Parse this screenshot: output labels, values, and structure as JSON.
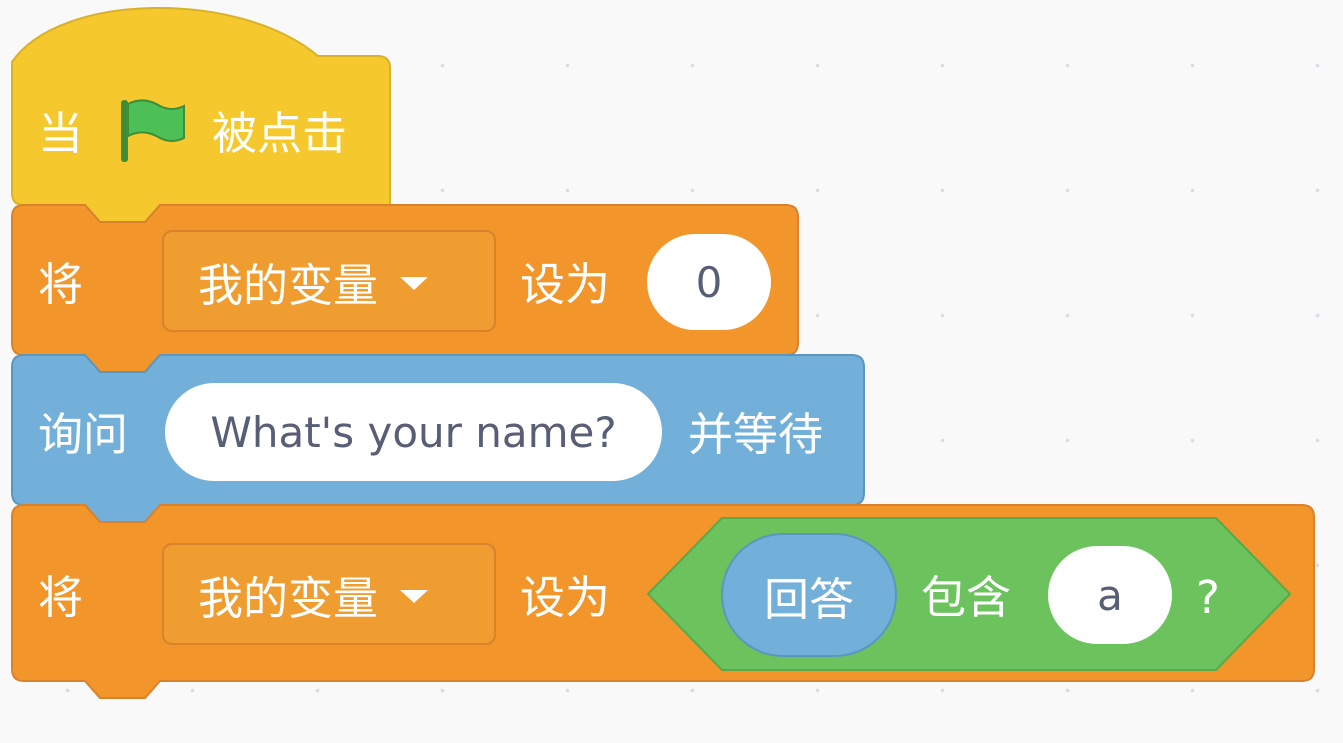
{
  "script": {
    "hat": {
      "prefix": "当",
      "icon": "green-flag-icon",
      "suffix": "被点击",
      "color": "#f5c82e"
    },
    "set_var_1": {
      "prefix": "将",
      "variable": "我的变量",
      "middle": "设为",
      "value": "0",
      "color": "#f2962b"
    },
    "ask": {
      "prefix": "询问",
      "question": "What's your name?",
      "suffix": "并等待",
      "color": "#73b0d9"
    },
    "set_var_2": {
      "prefix": "将",
      "variable": "我的变量",
      "middle": "设为",
      "contains": {
        "reporter": "回答",
        "operator": "包含",
        "value": "a",
        "suffix": "?",
        "color": "#6cc35e"
      },
      "color": "#f2962b"
    }
  }
}
